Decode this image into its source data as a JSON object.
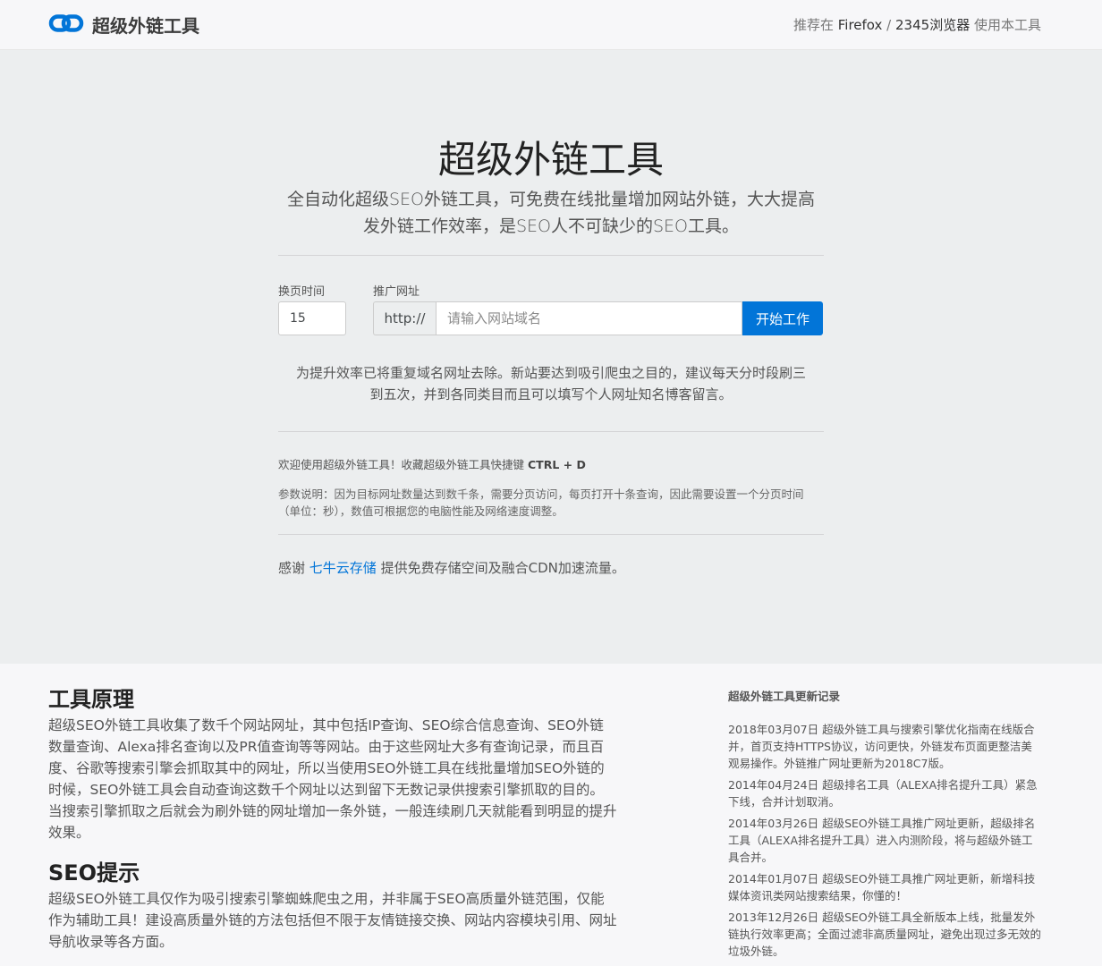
{
  "navbar": {
    "brand_name": "超级外链工具",
    "recommend_prefix": "推荐在",
    "firefox_label": "Firefox",
    "separator": "/",
    "browser2345_label": "2345浏览器",
    "recommend_suffix": "使用本工具"
  },
  "hero": {
    "title": "超级外链工具",
    "lead": "全自动化超级SEO外链工具，可免费在线批量增加网站外链，大大提高发外链工作效率，是SEO人不可缺少的SEO工具。"
  },
  "form": {
    "interval_label": "换页时间",
    "interval_value": "15",
    "url_label": "推广网址",
    "url_prefix": "http://",
    "url_placeholder": "请输入网站域名",
    "start_button": "开始工作"
  },
  "tip": "为提升效率已将重复域名网址去除。新站要达到吸引爬虫之目的，建议每天分时段刷三到五次，并到各同类目而且可以填写个人网址知名博客留言。",
  "welcome": {
    "text": "欢迎使用超级外链工具！收藏超级外链工具快捷键",
    "shortcut": "CTRL + D"
  },
  "param_text": "参数说明：因为目标网址数量达到数千条，需要分页访问，每页打开十条查询，因此需要设置一个分页时间（单位：秒），数值可根据您的电脑性能及网络速度调整。",
  "thanks": {
    "prefix": "感谢",
    "link": "七牛云存储",
    "suffix": "提供免费存储空间及融合CDN加速流量。"
  },
  "principle": {
    "title": "工具原理",
    "text": "超级SEO外链工具收集了数千个网站网址，其中包括IP查询、SEO综合信息查询、SEO外链数量查询、Alexa排名查询以及PR值查询等等网站。由于这些网址大多有查询记录，而且百度、谷歌等搜索引擎会抓取其中的网址，所以当使用SEO外链工具在线批量增加SEO外链的时候，SEO外链工具会自动查询这数千个网址以达到留下无数记录供搜索引擎抓取的目的。当搜索引擎抓取之后就会为刷外链的网址增加一条外链，一般连续刷几天就能看到明显的提升效果。"
  },
  "seo_tips": {
    "title": "SEO提示",
    "text": "超级SEO外链工具仅作为吸引搜索引擎蜘蛛爬虫之用，并非属于SEO高质量外链范围，仅能作为辅助工具！建设高质量外链的方法包括但不限于友情链接交换、网站内容模块引用、网址导航收录等各方面。"
  },
  "changelog": {
    "title": "超级外链工具更新记录",
    "items": [
      "2018年03月07日 超级外链工具与搜索引擎优化指南在线版合并，首页支持HTTPS协议，访问更快，外链发布页面更整洁美观易操作。外链推广网址更新为2018C7版。",
      "2014年04月24日 超级排名工具（ALEXA排名提升工具）紧急下线，合并计划取消。",
      "2014年03月26日 超级SEO外链工具推广网址更新，超级排名工具（ALEXA排名提升工具）进入内测阶段，将与超级外链工具合并。",
      "2014年01月07日 超级SEO外链工具推广网址更新，新增科技媒体资讯类网站搜索结果，你懂的！",
      "2013年12月26日 超级SEO外链工具全新版本上线，批量发外链执行效率更高；全面过滤非高质量网址，避免出现过多无效的垃圾外链。"
    ]
  },
  "colors": {
    "primary": "#0275d8",
    "jumbotron_bg": "#eceeef",
    "page_bg": "#f7f7f9"
  },
  "icons": {
    "brand": "chain-link-icon"
  }
}
